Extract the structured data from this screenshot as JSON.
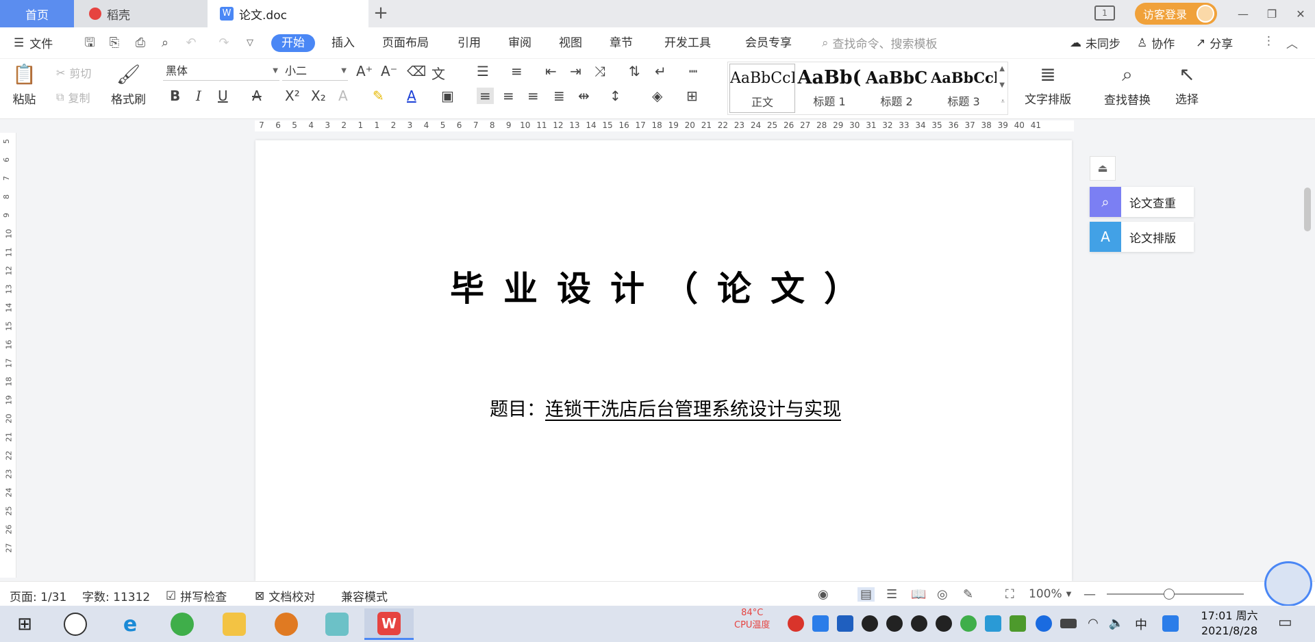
{
  "tabs": {
    "home": "首页",
    "daoke": "稻壳",
    "doc": "论文.doc",
    "add": "+"
  },
  "header": {
    "login": "访客登录",
    "layout_icon_text": "1"
  },
  "menu": {
    "file": "文件",
    "items": [
      "开始",
      "插入",
      "页面布局",
      "引用",
      "审阅",
      "视图",
      "章节",
      "开发工具",
      "会员专享"
    ],
    "search_placeholder": "查找命令、搜索模板",
    "sync": "未同步",
    "collab": "协作",
    "share": "分享"
  },
  "ribbon": {
    "paste": "粘贴",
    "cut": "剪切",
    "copy": "复制",
    "format_painter": "格式刷",
    "font_name": "黑体",
    "font_size": "小二",
    "styles": [
      {
        "sample": "AaBbCcI",
        "name": "正文"
      },
      {
        "sample": "AaBb(",
        "name": "标题 1"
      },
      {
        "sample": "AaBbC",
        "name": "标题 2"
      },
      {
        "sample": "AaBbCcl",
        "name": "标题 3"
      }
    ],
    "text_layout": "文字排版",
    "find_replace": "查找替换",
    "select": "选择"
  },
  "ruler": {
    "ticks": [
      "7",
      "6",
      "5",
      "4",
      "3",
      "2",
      "1",
      "1",
      "2",
      "3",
      "4",
      "5",
      "6",
      "7",
      "8",
      "9",
      "10",
      "11",
      "12",
      "13",
      "14",
      "15",
      "16",
      "17",
      "18",
      "19",
      "20",
      "21",
      "22",
      "23",
      "24",
      "25",
      "26",
      "27",
      "28",
      "29",
      "30",
      "31",
      "32",
      "33",
      "34",
      "35",
      "36",
      "37",
      "38",
      "39",
      "40",
      "41"
    ],
    "vticks": [
      "5",
      "6",
      "7",
      "8",
      "9",
      "10",
      "11",
      "12",
      "13",
      "14",
      "15",
      "16",
      "17",
      "18",
      "19",
      "20",
      "21",
      "22",
      "23",
      "24",
      "25",
      "26",
      "27"
    ]
  },
  "document": {
    "title": "毕业设计（论文）",
    "subject_label": "题目：",
    "subject_value": "连锁干洗店后台管理系统设计与实现"
  },
  "side_panel": {
    "check": "论文查重",
    "format": "论文排版"
  },
  "status": {
    "page": "页面: 1/31",
    "words": "字数: 11312",
    "spellcheck": "拼写检查",
    "proofread": "文档校对",
    "compat": "兼容模式",
    "zoom": "100%",
    "zoom_level": 1.0
  },
  "taskbar": {
    "ime": "中",
    "time": "17:01 周六",
    "date": "2021/8/28",
    "cpu_temp": "84°C",
    "cpu_label": "CPU温度"
  },
  "colors": {
    "accent": "#4a87f5",
    "home_tab": "#5b8def",
    "login": "#f0a13a",
    "wps_red": "#e64340"
  }
}
